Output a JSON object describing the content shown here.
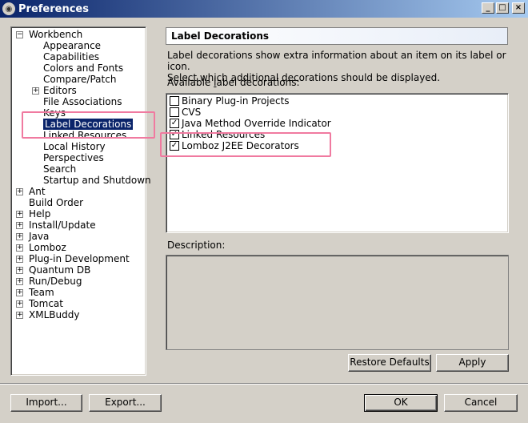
{
  "window": {
    "title": "Preferences",
    "buttons": {
      "minimize": "_",
      "maximize": "□",
      "close": "×"
    }
  },
  "tree": {
    "items": [
      {
        "label": "Workbench",
        "level": 0,
        "expander": "−"
      },
      {
        "label": "Appearance",
        "level": 1
      },
      {
        "label": "Capabilities",
        "level": 1
      },
      {
        "label": "Colors and Fonts",
        "level": 1
      },
      {
        "label": "Compare/Patch",
        "level": 1
      },
      {
        "label": "Editors",
        "level": 1,
        "expander": "+"
      },
      {
        "label": "File Associations",
        "level": 1
      },
      {
        "label": "Keys",
        "level": 1
      },
      {
        "label": "Label Decorations",
        "level": 1,
        "selected": true
      },
      {
        "label": "Linked Resources",
        "level": 1
      },
      {
        "label": "Local History",
        "level": 1
      },
      {
        "label": "Perspectives",
        "level": 1
      },
      {
        "label": "Search",
        "level": 1
      },
      {
        "label": "Startup and Shutdown",
        "level": 1
      },
      {
        "label": "Ant",
        "level": 0,
        "expander": "+"
      },
      {
        "label": "Build Order",
        "level": 0
      },
      {
        "label": "Help",
        "level": 0,
        "expander": "+"
      },
      {
        "label": "Install/Update",
        "level": 0,
        "expander": "+"
      },
      {
        "label": "Java",
        "level": 0,
        "expander": "+"
      },
      {
        "label": "Lomboz",
        "level": 0,
        "expander": "+"
      },
      {
        "label": "Plug-in Development",
        "level": 0,
        "expander": "+"
      },
      {
        "label": "Quantum DB",
        "level": 0,
        "expander": "+"
      },
      {
        "label": "Run/Debug",
        "level": 0,
        "expander": "+"
      },
      {
        "label": "Team",
        "level": 0,
        "expander": "+"
      },
      {
        "label": "Tomcat",
        "level": 0,
        "expander": "+"
      },
      {
        "label": "XMLBuddy",
        "level": 0,
        "expander": "+"
      }
    ]
  },
  "panel": {
    "title": "Label Decorations",
    "description_line1": "Label decorations show extra information about an item on its label or icon.",
    "description_line2": "Select which additional decorations should be displayed.",
    "list_label_pre": "Available ",
    "list_label_mnemonic": "l",
    "list_label_post": "abel decorations:",
    "decorations": [
      {
        "label": "Binary Plug-in Projects",
        "checked": false
      },
      {
        "label": "CVS",
        "checked": false
      },
      {
        "label": "Java Method Override Indicator",
        "checked": true
      },
      {
        "label": "Linked Resources",
        "checked": true
      },
      {
        "label": "Lomboz J2EE Decorators",
        "checked": true
      }
    ],
    "description_label_pre": "Description",
    "description_label_post": ":",
    "description_label_mnemonic": ""
  },
  "buttons": {
    "restore_defaults": "Restore Defaults",
    "apply": "Apply",
    "import": "Import...",
    "export": "Export...",
    "ok": "OK",
    "cancel": "Cancel"
  },
  "colors": {
    "titlebar": "#0a246a",
    "selection": "#0a246a",
    "annotation": "#f07aa0",
    "dialog_bg": "#d4d0c8"
  }
}
